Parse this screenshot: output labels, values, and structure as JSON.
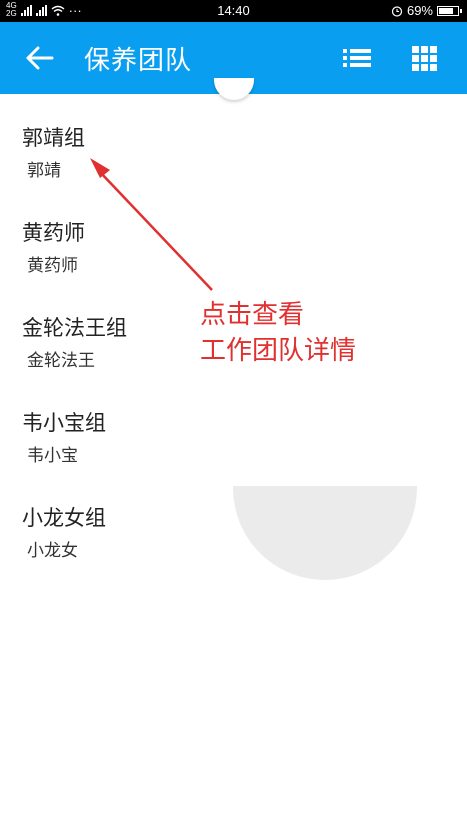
{
  "status_bar": {
    "network": [
      "4G",
      "2G"
    ],
    "time": "14:40",
    "battery": "69%",
    "battery_fraction": 0.69,
    "icons": [
      "signal-icon",
      "wifi-icon",
      "more-dots-icon",
      "alarm-icon",
      "battery-icon"
    ]
  },
  "app_bar": {
    "title": "保养团队",
    "background": "#0a9ef0",
    "icons": [
      "back-arrow-icon",
      "list-view-icon",
      "grid-view-icon"
    ]
  },
  "teams": [
    {
      "name": "郭靖组",
      "leader": "郭靖"
    },
    {
      "name": "黄药师",
      "leader": "黄药师"
    },
    {
      "name": "金轮法王组",
      "leader": "金轮法王"
    },
    {
      "name": "韦小宝组",
      "leader": "韦小宝"
    },
    {
      "name": "小龙女组",
      "leader": "小龙女"
    }
  ],
  "annotation": {
    "line1": "点击查看",
    "line2": "工作团队详情",
    "color": "#e03030"
  }
}
